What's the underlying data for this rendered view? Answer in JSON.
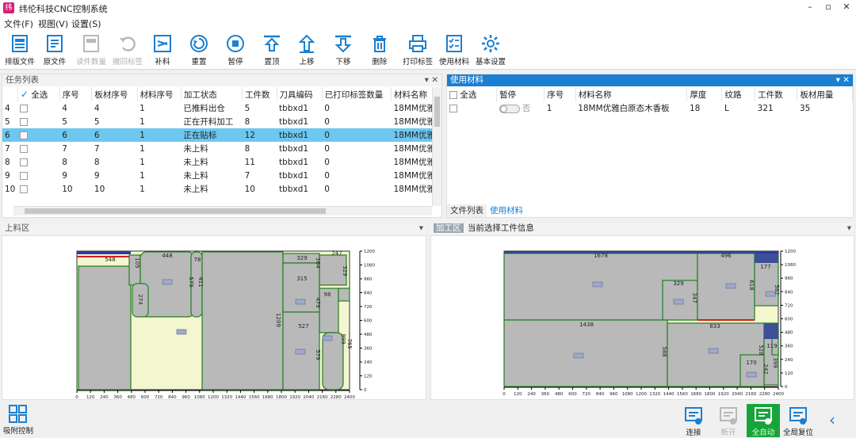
{
  "app": {
    "title": "纬伦科技CNC控制系统",
    "icon_label": "纬"
  },
  "window": {
    "min": "–",
    "restore": "▫",
    "close": "✕"
  },
  "menu": [
    "文件(F)",
    "视图(V)",
    "设置(S)"
  ],
  "toolbar": [
    {
      "label": "排版文件",
      "icon": "layout-file-icon",
      "disabled": false
    },
    {
      "label": "原文件",
      "icon": "source-file-icon",
      "disabled": false
    },
    {
      "label": "读件数量",
      "icon": "count-icon",
      "disabled": true
    },
    {
      "label": "撤回标签",
      "icon": "undo-label-icon",
      "disabled": true
    },
    {
      "label": "补料",
      "icon": "supplement-icon",
      "disabled": false
    },
    {
      "label": "重置",
      "icon": "reset-icon",
      "disabled": false
    },
    {
      "label": "暂停",
      "icon": "pause-icon",
      "disabled": false
    },
    {
      "label": "置顶",
      "icon": "pin-top-icon",
      "disabled": false
    },
    {
      "label": "上移",
      "icon": "move-up-icon",
      "disabled": false
    },
    {
      "label": "下移",
      "icon": "move-down-icon",
      "disabled": false
    },
    {
      "label": "删除",
      "icon": "delete-icon",
      "disabled": false
    },
    {
      "label": "打印标签",
      "icon": "print-icon",
      "disabled": false
    },
    {
      "label": "使用材料",
      "icon": "material-list-icon",
      "disabled": false
    },
    {
      "label": "基本设置",
      "icon": "settings-icon",
      "disabled": false
    }
  ],
  "task_panel": {
    "title": "任务列表",
    "pin": "▾ ✕",
    "columns": [
      "全选",
      "序号",
      "板材序号",
      "材料序号",
      "加工状态",
      "工件数",
      "刀具编码",
      "已打印标签数量",
      "材料名称"
    ],
    "rows": [
      {
        "idx": "4",
        "seq": "4",
        "board": "4",
        "mat": "1",
        "status": "已推料出仓",
        "count": "5",
        "tool": "tbbxd1",
        "printed": "0",
        "name": "18MM优雅"
      },
      {
        "idx": "5",
        "seq": "5",
        "board": "5",
        "mat": "1",
        "status": "正在开料加工",
        "count": "8",
        "tool": "tbbxd1",
        "printed": "0",
        "name": "18MM优雅"
      },
      {
        "idx": "6",
        "seq": "6",
        "board": "6",
        "mat": "1",
        "status": "正在贴标",
        "count": "12",
        "tool": "tbbxd1",
        "printed": "0",
        "name": "18MM优雅"
      },
      {
        "idx": "7",
        "seq": "7",
        "board": "7",
        "mat": "1",
        "status": "未上料",
        "count": "8",
        "tool": "tbbxd1",
        "printed": "0",
        "name": "18MM优雅"
      },
      {
        "idx": "8",
        "seq": "8",
        "board": "8",
        "mat": "1",
        "status": "未上料",
        "count": "11",
        "tool": "tbbxd1",
        "printed": "0",
        "name": "18MM优雅"
      },
      {
        "idx": "9",
        "seq": "9",
        "board": "9",
        "mat": "1",
        "status": "未上料",
        "count": "7",
        "tool": "tbbxd1",
        "printed": "0",
        "name": "18MM优雅"
      },
      {
        "idx": "10",
        "seq": "10",
        "board": "10",
        "mat": "1",
        "status": "未上料",
        "count": "10",
        "tool": "tbbxd1",
        "printed": "0",
        "name": "18MM优雅"
      }
    ],
    "selected_index": 2
  },
  "material_panel": {
    "title": "使用材料",
    "pin": "▾ ✕",
    "columns": [
      "全选",
      "暂停",
      "序号",
      "材料名称",
      "厚度",
      "纹路",
      "工件数",
      "板材用量"
    ],
    "rows": [
      {
        "pause": "否",
        "seq": "1",
        "name": "18MM优雅白原态木香板",
        "thick": "18",
        "grain": "L",
        "count": "321",
        "usage": "35"
      }
    ],
    "tabs": [
      "文件列表",
      "使用材料"
    ],
    "active_tab": 1
  },
  "load_panel": {
    "title": "上料区",
    "pin": "▾"
  },
  "machining_panel": {
    "title": "加工区",
    "subtitle": "当前选择工件信息",
    "pin": "▾"
  },
  "axis": {
    "x_ticks": [
      "0",
      "120",
      "240",
      "360",
      "480",
      "600",
      "720",
      "840",
      "960",
      "1080",
      "1200",
      "1320",
      "1440",
      "1560",
      "1680",
      "1800",
      "1920",
      "2040",
      "2160",
      "2280",
      "2400"
    ],
    "y_ticks": [
      "0",
      "120",
      "240",
      "360",
      "480",
      "600",
      "720",
      "840",
      "960",
      "1080",
      "1200"
    ]
  },
  "load_sheet_labels": [
    "548",
    "448",
    "105",
    "78",
    "579",
    "411",
    "274",
    "1209",
    "329",
    "164",
    "315",
    "247",
    "329",
    "98",
    "479",
    "579",
    "527",
    "899",
    "765"
  ],
  "machining_sheet_labels": [
    "1678",
    "496",
    "329",
    "347",
    "618",
    "177",
    "582",
    "1438",
    "833",
    "588",
    "119",
    "528",
    "170",
    "242",
    "399"
  ],
  "bottom": {
    "left": {
      "label": "吸附控制",
      "icon": "grid-icon"
    },
    "right": [
      {
        "label": "连接",
        "icon": "connect-icon",
        "disabled": false
      },
      {
        "label": "断开",
        "icon": "disconnect-icon",
        "disabled": true
      },
      {
        "label": "全自动",
        "icon": "auto-run-icon",
        "disabled": false,
        "active": true
      },
      {
        "label": "全局复位",
        "icon": "global-reset-icon",
        "disabled": false
      }
    ],
    "collapse": "‹"
  },
  "colors": {
    "accent": "#1a7fd1",
    "selected_row": "#6ec7ef",
    "part_fill": "#b9b9b9",
    "part_edge": "#1f7f1f",
    "waste": "#f4f6cf",
    "active_btn": "#17a53b"
  }
}
